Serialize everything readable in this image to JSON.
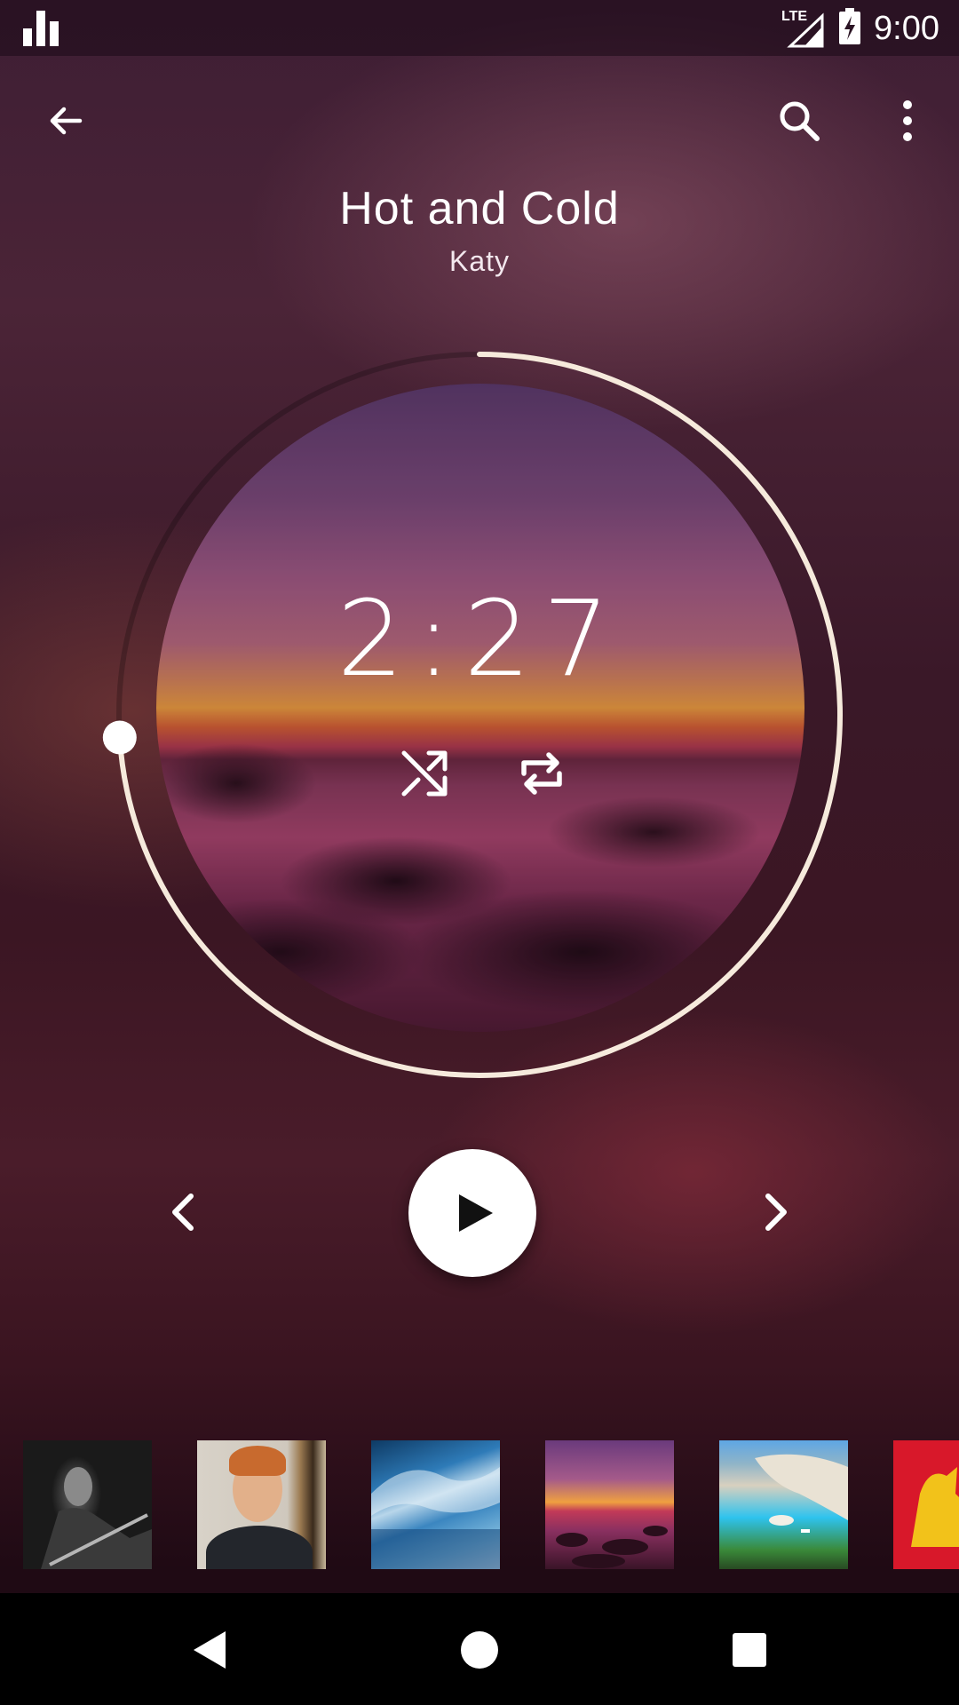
{
  "status_bar": {
    "time": "9:00",
    "network_label": "LTE",
    "icons": [
      "bar-chart-icon",
      "signal-icon",
      "battery-charging-icon"
    ]
  },
  "app_bar": {
    "icons": [
      "arrow-back-icon",
      "search-icon",
      "more-vert-icon"
    ]
  },
  "now_playing": {
    "title": "Hot and Cold",
    "artist": "Katy",
    "elapsed": "2:27",
    "progress": 0.74
  },
  "controls": {
    "icons": [
      "shuffle-icon",
      "repeat-icon",
      "previous-icon",
      "play-icon",
      "next-icon"
    ]
  },
  "thumbnails": [
    {
      "name": "thumb-guitarist-bw"
    },
    {
      "name": "thumb-redhead-guitar"
    },
    {
      "name": "thumb-ocean-wave"
    },
    {
      "name": "thumb-sunset-shore"
    },
    {
      "name": "thumb-bay-cliffs"
    },
    {
      "name": "thumb-red-lion"
    }
  ],
  "nav_bar": {
    "icons": [
      "nav-back-icon",
      "nav-home-icon",
      "nav-recents-icon"
    ]
  },
  "colors": {
    "ring": "#f6eadc",
    "play_button": "#ffffff",
    "background": "#3a1828"
  }
}
